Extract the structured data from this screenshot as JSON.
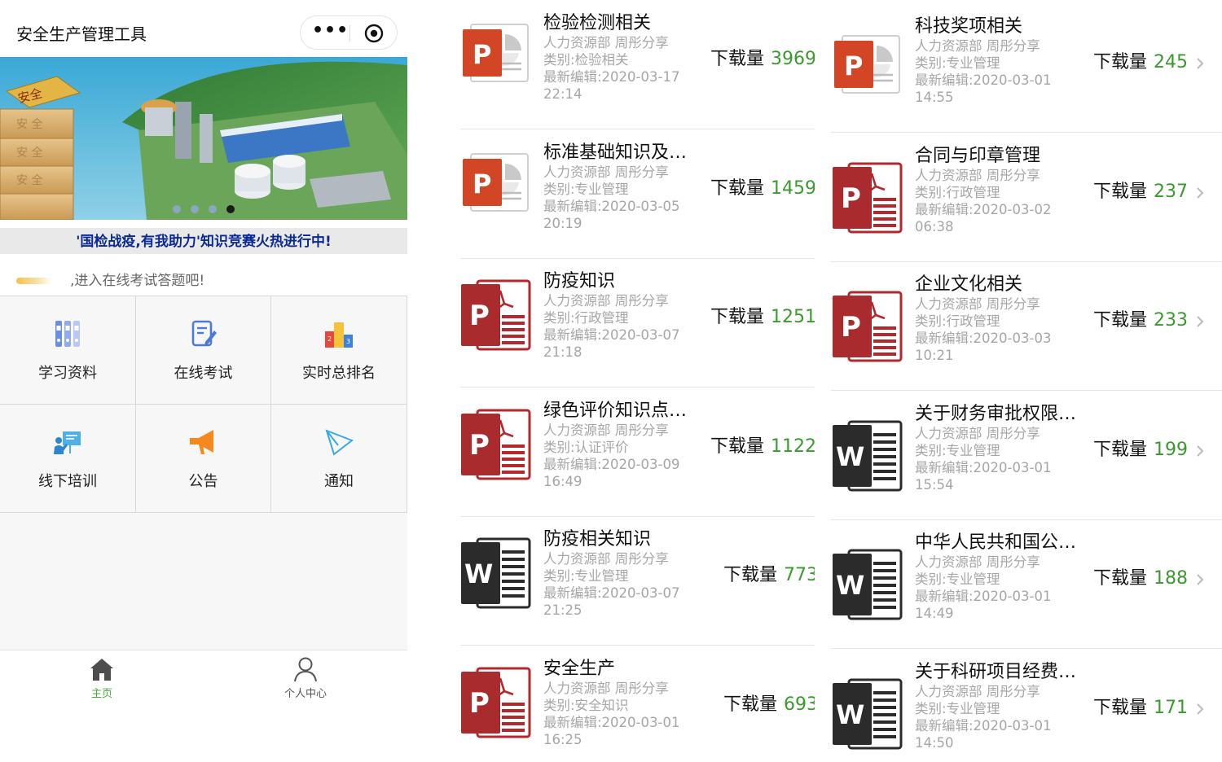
{
  "app": {
    "title": "安全生产管理工具",
    "more_icon": "more-dots-icon",
    "close_icon": "target-circle-icon"
  },
  "banner": {
    "image": "cement-plant-aerial-with-safety-blocks",
    "block_texts": [
      "安全",
      "安 全",
      "安 全",
      "安 全"
    ],
    "slide_count": 4,
    "active_slide": 4
  },
  "notice": "'国检战疫,有我助力'知识竞赛火热进行中!",
  "hint": ",进入在线考试答题吧!",
  "menu": [
    {
      "label": "学习资料",
      "icon": "binders-icon"
    },
    {
      "label": "在线考试",
      "icon": "edit-document-icon"
    },
    {
      "label": "实时总排名",
      "icon": "podium-icon"
    },
    {
      "label": "线下培训",
      "icon": "presentation-icon"
    },
    {
      "label": "公告",
      "icon": "megaphone-icon"
    },
    {
      "label": "通知",
      "icon": "paper-plane-icon"
    }
  ],
  "tabbar": [
    {
      "label": "主页",
      "icon": "home-icon",
      "active": true
    },
    {
      "label": "个人中心",
      "icon": "person-icon",
      "active": false
    }
  ],
  "colors": {
    "accent_green": "#3a9a2e",
    "notice_blue": "#0a2a92",
    "ppt_orange": "#d24625",
    "pdf_red": "#b3282d",
    "word_dark": "#2b2b2b"
  },
  "dl_label": "下载量",
  "docs_left": [
    {
      "title": "检验检测相关",
      "author": "人力资源部 周彤分享",
      "category": "类别:检验相关",
      "edited": "最新编辑:2020-03-17",
      "time": "22:14",
      "downloads": "3969",
      "icon": "ppt-icon"
    },
    {
      "title": "标准基础知识及…",
      "author": "人力资源部 周彤分享",
      "category": "类别:专业管理",
      "edited": "最新编辑:2020-03-05",
      "time": "20:19",
      "downloads": "1459",
      "icon": "ppt-icon"
    },
    {
      "title": "防疫知识",
      "author": "人力资源部 周彤分享",
      "category": "类别:行政管理",
      "edited": "最新编辑:2020-03-07",
      "time": "21:18",
      "downloads": "1251",
      "icon": "pdf-icon"
    },
    {
      "title": "绿色评价知识点…",
      "author": "人力资源部 周彤分享",
      "category": "类别:认证评价",
      "edited": "最新编辑:2020-03-09",
      "time": "16:49",
      "downloads": "1122",
      "icon": "pdf-icon"
    },
    {
      "title": "防疫相关知识",
      "author": "人力资源部 周彤分享",
      "category": "类别:专业管理",
      "edited": "最新编辑:2020-03-07",
      "time": "21:25",
      "downloads": "773",
      "icon": "word-icon"
    },
    {
      "title": "安全生产",
      "author": "人力资源部 周彤分享",
      "category": "类别:安全知识",
      "edited": "最新编辑:2020-03-01",
      "time": "16:25",
      "downloads": "693",
      "icon": "pdf-icon"
    }
  ],
  "docs_right": [
    {
      "title": "科技奖项相关",
      "author": "人力资源部 周彤分享",
      "category": "类别:专业管理",
      "edited": "最新编辑:2020-03-01",
      "time": "14:55",
      "downloads": "245",
      "icon": "ppt-icon"
    },
    {
      "title": "合同与印章管理",
      "author": "人力资源部 周彤分享",
      "category": "类别:行政管理",
      "edited": "最新编辑:2020-03-02",
      "time": "06:38",
      "downloads": "237",
      "icon": "pdf-icon"
    },
    {
      "title": "企业文化相关",
      "author": "人力资源部 周彤分享",
      "category": "类别:行政管理",
      "edited": "最新编辑:2020-03-03",
      "time": "10:21",
      "downloads": "233",
      "icon": "pdf-icon"
    },
    {
      "title": "关于财务审批权限…",
      "author": "人力资源部 周彤分享",
      "category": "类别:专业管理",
      "edited": "最新编辑:2020-03-01",
      "time": "15:54",
      "downloads": "199",
      "icon": "word-icon"
    },
    {
      "title": "中华人民共和国公…",
      "author": "人力资源部 周彤分享",
      "category": "类别:专业管理",
      "edited": "最新编辑:2020-03-01",
      "time": "14:49",
      "downloads": "188",
      "icon": "word-icon"
    },
    {
      "title": "关于科研项目经费…",
      "author": "人力资源部 周彤分享",
      "category": "类别:专业管理",
      "edited": "最新编辑:2020-03-01",
      "time": "14:50",
      "downloads": "171",
      "icon": "word-icon"
    }
  ]
}
